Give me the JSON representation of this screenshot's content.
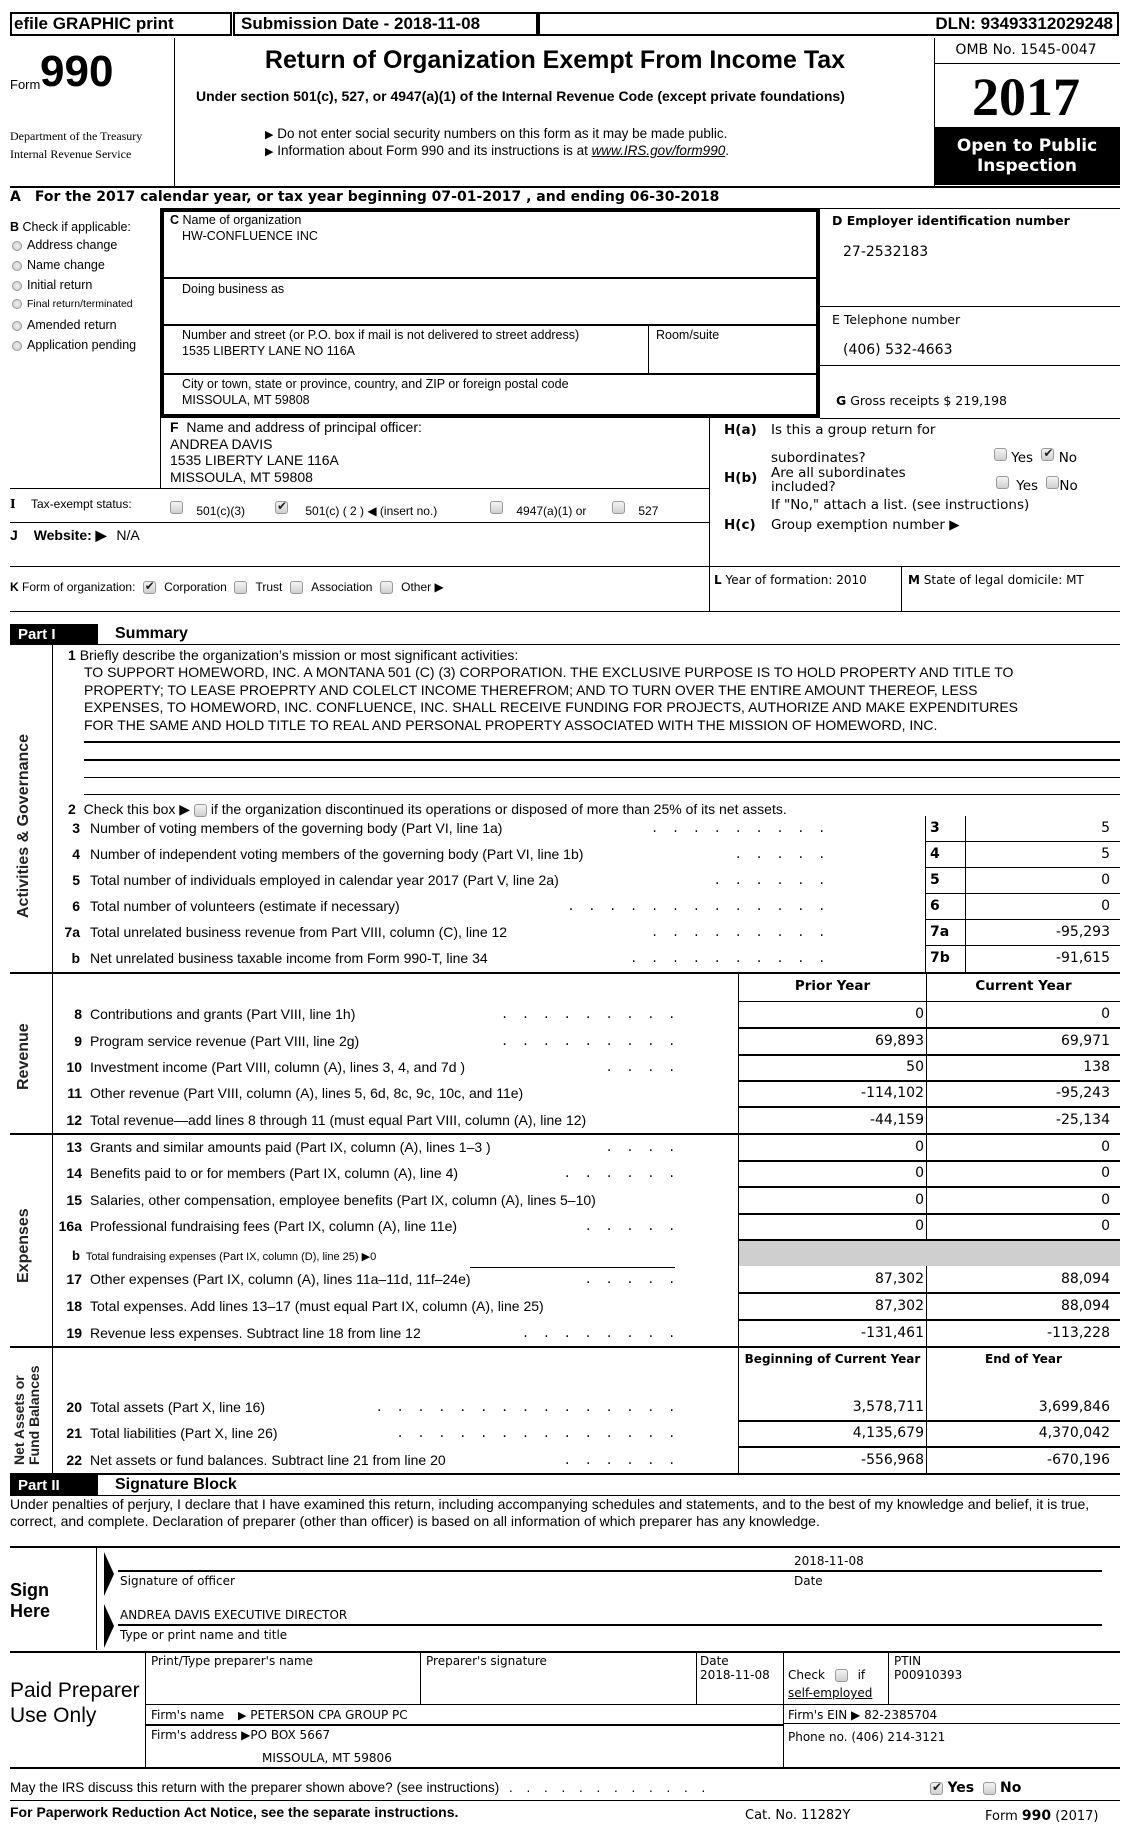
{
  "header": {
    "efile_label": "efile GRAPHIC print",
    "submission_date": "Submission Date - 2018-11-08",
    "dln": "DLN: 93493312029248",
    "form_prefix": "Form",
    "form_number": "990",
    "department": "Department of the Treasury",
    "irs": "Internal Revenue Service",
    "title": "Return of Organization Exempt From Income Tax",
    "subtitle": "Under section 501(c), 527, or 4947(a)(1) of the Internal Revenue Code (except private foundations)",
    "note1": "Do not enter social security numbers on this form as it may be made public.",
    "note2_prefix": "Information about Form 990 and its instructions is at",
    "note2_link": "www.IRS.gov/form990",
    "note2_suffix": ".",
    "omb": "OMB No. 1545-0047",
    "year": "2017",
    "open_public": "Open to Public Inspection"
  },
  "line_a": {
    "label": "A",
    "text": "For the 2017 calendar year, or tax year beginning 07-01-2017   , and ending 06-30-2018"
  },
  "section_b": {
    "title_letter": "B",
    "title": "Check if applicable:",
    "options": [
      {
        "label": "Address change",
        "checked": false
      },
      {
        "label": "Name change",
        "checked": false
      },
      {
        "label": "Initial return",
        "checked": false
      },
      {
        "label": "Final return/terminated",
        "checked": false
      },
      {
        "label": "Amended return",
        "checked": false
      },
      {
        "label": "Application pending",
        "checked": false
      }
    ]
  },
  "section_c": {
    "letter": "C",
    "name_label": "Name of organization",
    "name_value": "HW-CONFLUENCE INC",
    "dba_label": "Doing business as",
    "dba_value": "",
    "street_label": "Number and street (or P.O. box if mail is not delivered to street address)",
    "street_value": "1535 LIBERTY LANE NO 116A",
    "room_label": "Room/suite",
    "room_value": "",
    "city_label": "City or town, state or province, country, and ZIP or foreign postal code",
    "city_value": "MISSOULA, MT  59808"
  },
  "section_d": {
    "label": "D Employer identification number",
    "value": "27-2532183"
  },
  "section_e": {
    "label": "E Telephone number",
    "value": "(406) 532-4663"
  },
  "section_g": {
    "letter": "G",
    "label": "Gross receipts $ 219,198"
  },
  "section_f": {
    "letter": "F",
    "label": "Name and address of principal officer:",
    "lines": [
      "ANDREA DAVIS",
      "1535 LIBERTY LANE 116A",
      "MISSOULA, MT  59808"
    ]
  },
  "section_h": {
    "ha_label": "H(a)",
    "ha_text1": "Is this a group return for",
    "ha_text2": "subordinates?",
    "hb_label": "H(b)",
    "hb_text1": "Are all subordinates",
    "hb_text2": "included?",
    "hb_note": "If \"No,\" attach a list. (see instructions)",
    "hc_label": "H(c)",
    "hc_text": "Group exemption number ▶",
    "yes": "Yes",
    "no": "No",
    "ha_yes": false,
    "ha_no": true,
    "hb_yes": false,
    "hb_no": false
  },
  "section_i": {
    "letter": "I",
    "label": "Tax-exempt status:",
    "opt1": "501(c)(3)",
    "opt2": "501(c) ( 2 ) ◀ (insert no.)",
    "opt3": "4947(a)(1) or",
    "opt4": "527",
    "opt1_checked": false,
    "opt2_checked": true,
    "opt3_checked": false,
    "opt4_checked": false
  },
  "section_j": {
    "letter": "J",
    "label": "Website: ▶",
    "value": "N/A"
  },
  "section_k": {
    "letter": "K",
    "label": "Form of organization:",
    "opt1": "Corporation",
    "opt2": "Trust",
    "opt3": "Association",
    "opt4": "Other ▶",
    "opt1_checked": true
  },
  "section_l": {
    "letter": "L",
    "label": "Year of formation: 2010"
  },
  "section_m": {
    "letter": "M",
    "label": "State of legal domicile: MT"
  },
  "part1": {
    "part_label": "Part I",
    "title": "Summary",
    "side_activities": "Activities & Governance",
    "side_revenue": "Revenue",
    "side_expenses": "Expenses",
    "side_net1": "Net Assets or",
    "side_net2": "Fund Balances",
    "line1_num": "1",
    "line1_label": "Briefly describe the organization’s mission or most significant activities:",
    "mission": [
      "TO SUPPORT HOMEWORD, INC. A MONTANA 501 (C) (3) CORPORATION. THE EXCLUSIVE PURPOSE IS TO HOLD PROPERTY AND TITLE TO",
      "PROPERTY; TO LEASE PROEPRTY AND COLELCT INCOME THEREFROM; AND TO TURN OVER THE ENTIRE AMOUNT THEREOF, LESS",
      "EXPENSES, TO HOMEWORD, INC. CONFLUENCE, INC. SHALL RECEIVE FUNDING FOR PROJECTS, AUTHORIZE AND MAKE EXPENDITURES",
      "FOR THE SAME AND HOLD TITLE TO REAL AND PERSONAL PROPERTY ASSOCIATED WITH THE MISSION OF HOMEWORD, INC."
    ],
    "line2_num": "2",
    "line2_pre": "Check this box ▶",
    "line2_post": "if the organization discontinued its operations or disposed of more than 25% of its net assets.",
    "gov_lines": [
      {
        "num": "3",
        "text": "Number of voting members of the governing body (Part VI, line 1a)",
        "dots": ". . . . . . . . .",
        "box": "3",
        "value": "5"
      },
      {
        "num": "4",
        "text": "Number of independent voting members of the governing body (Part VI, line 1b)",
        "dots": ". . . . .",
        "box": "4",
        "value": "5"
      },
      {
        "num": "5",
        "text": "Total number of individuals employed in calendar year 2017 (Part V, line 2a)",
        "dots": ". . . . . .",
        "box": "5",
        "value": "0"
      },
      {
        "num": "6",
        "text": "Total number of volunteers (estimate if necessary)",
        "dots": ". . . . . . . . . . . . .",
        "box": "6",
        "value": "0"
      },
      {
        "num": "7a",
        "text": "Total unrelated business revenue from Part VIII, column (C), line 12",
        "dots": ". . . . . . . . .",
        "box": "7a",
        "value": "-95,293"
      },
      {
        "num": "b",
        "text": "Net unrelated business taxable income from Form 990-T, line 34",
        "dots": ". . . . . . . . . .",
        "box": "7b",
        "value": "-91,615"
      }
    ],
    "col_prior": "Prior Year",
    "col_current": "Current Year",
    "revenue_lines": [
      {
        "num": "8",
        "text": "Contributions and grants (Part VIII, line 1h)",
        "dots": ". . . . . . . . .",
        "prior": "0",
        "current": "0"
      },
      {
        "num": "9",
        "text": "Program service revenue (Part VIII, line 2g)",
        "dots": ". . . . . . . . .",
        "prior": "69,893",
        "current": "69,971"
      },
      {
        "num": "10",
        "text": "Investment income (Part VIII, column (A), lines 3, 4, and 7d )",
        "dots": ". . . .",
        "prior": "50",
        "current": "138"
      },
      {
        "num": "11",
        "text": "Other revenue (Part VIII, column (A), lines 5, 6d, 8c, 9c, 10c, and 11e)",
        "dots": "",
        "prior": "-114,102",
        "current": "-95,243"
      },
      {
        "num": "12",
        "text": "Total revenue—add lines 8 through 11 (must equal Part VIII, column (A), line 12)",
        "dots": "",
        "prior": "-44,159",
        "current": "-25,134"
      }
    ],
    "expense_lines": [
      {
        "num": "13",
        "text": "Grants and similar amounts paid (Part IX, column (A), lines 1–3 )",
        "dots": ". . . .",
        "prior": "0",
        "current": "0"
      },
      {
        "num": "14",
        "text": "Benefits paid to or for members (Part IX, column (A), line 4)",
        "dots": ". . . . . .",
        "prior": "0",
        "current": "0"
      },
      {
        "num": "15",
        "text": "Salaries, other compensation, employee benefits (Part IX, column (A), lines 5–10)",
        "dots": "",
        "prior": "0",
        "current": "0"
      },
      {
        "num": "16a",
        "text": "Professional fundraising fees (Part IX, column (A), line 11e)",
        "dots": ". . . . .",
        "prior": "0",
        "current": "0"
      }
    ],
    "line16b_num": "b",
    "line16b_text": "Total fundraising expenses (Part IX, column (D), line 25) ▶0",
    "expense_lines2": [
      {
        "num": "17",
        "text": "Other expenses (Part IX, column (A), lines 11a–11d, 11f–24e)",
        "dots": ". . . . .",
        "prior": "87,302",
        "current": "88,094"
      },
      {
        "num": "18",
        "text": "Total expenses. Add lines 13–17 (must equal Part IX, column (A), line 25)",
        "dots": "",
        "prior": "87,302",
        "current": "88,094"
      },
      {
        "num": "19",
        "text": "Revenue less expenses. Subtract line 18 from line 12",
        "dots": ". . . . . . . .",
        "prior": "-131,461",
        "current": "-113,228"
      }
    ],
    "col_begin": "Beginning of Current Year",
    "col_end": "End of Year",
    "net_lines": [
      {
        "num": "20",
        "text": "Total assets (Part X, line 16)",
        "dots": ". . . . . . . . . . . . . . .",
        "begin": "3,578,711",
        "end": "3,699,846"
      },
      {
        "num": "21",
        "text": "Total liabilities (Part X, line 26)",
        "dots": ". . . . . . . . . . . . . .",
        "begin": "4,135,679",
        "end": "4,370,042"
      },
      {
        "num": "22",
        "text": "Net assets or fund balances. Subtract line 21 from line 20",
        "dots": ". . . . . .",
        "begin": "-556,968",
        "end": "-670,196"
      }
    ]
  },
  "part2": {
    "part_label": "Part II",
    "title": "Signature Block",
    "perjury": "Under penalties of perjury, I declare that I have examined this return, including accompanying schedules and statements, and to the best of my knowledge and belief, it is true, correct, and complete. Declaration of preparer (other than officer) is based on all information of which preparer has any knowledge.",
    "sign_here": "Sign Here",
    "sign_date_value": "2018-11-08",
    "signature_label": "Signature of officer",
    "date_label": "Date",
    "name_title_value": "ANDREA DAVIS EXECUTIVE DIRECTOR",
    "name_title_label": "Type or print name and title"
  },
  "preparer": {
    "heading": "Paid Preparer Use Only",
    "name_label": "Print/Type preparer's name",
    "sig_label": "Preparer's signature",
    "date_label": "Date",
    "date_value": "2018-11-08",
    "check_label": "Check",
    "check_if": "if",
    "self_employed": "self-employed",
    "ptin_label": "PTIN",
    "ptin_value": "P00910393",
    "firm_name_label": "Firm's name",
    "firm_name_value": "PETERSON CPA GROUP PC",
    "firm_ein_label": "Firm's EIN ▶",
    "firm_ein_value": "82-2385704",
    "firm_address_label": "Firm's address ▶",
    "firm_address_line1": "PO BOX 5667",
    "firm_address_line2": "MISSOULA, MT  59806",
    "phone_label": "Phone no. (406) 214-3121"
  },
  "footer": {
    "discuss": "May the IRS discuss this return with the preparer shown above? (see instructions)",
    "discuss_dots": ". . . . . . . . . . . .",
    "yes": "Yes",
    "no": "No",
    "discuss_yes": true,
    "paperwork": "For Paperwork Reduction Act Notice, see the separate instructions.",
    "cat_no": "Cat. No. 11282Y",
    "form_pre": "Form",
    "form_num": "990",
    "form_year": "(2017)"
  }
}
